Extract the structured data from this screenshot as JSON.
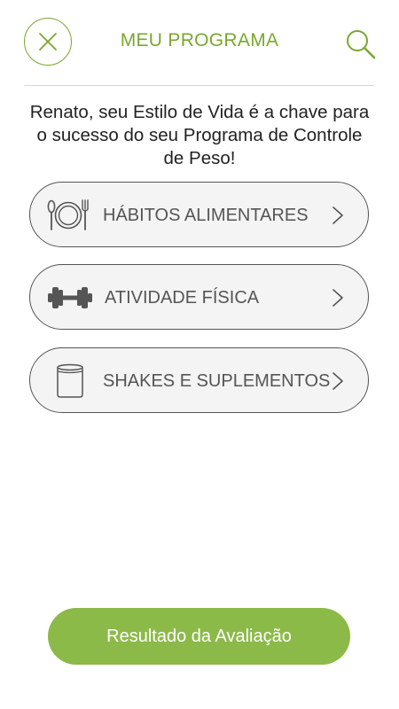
{
  "header": {
    "title": "MEU PROGRAMA",
    "close_icon": "close-icon",
    "search_icon": "search-icon"
  },
  "intro": {
    "text": "Renato, seu Estilo de Vida é a chave para o sucesso do seu Programa de Controle de Peso!"
  },
  "menu": {
    "items": [
      {
        "label": "HÁBITOS ALIMENTARES",
        "icon": "plate-cutlery-icon"
      },
      {
        "label": "ATIVIDADE FÍSICA",
        "icon": "dumbbell-icon"
      },
      {
        "label": "SHAKES E SUPLEMENTOS",
        "icon": "canister-icon"
      }
    ]
  },
  "footer": {
    "button_label": "Resultado da Avaliação"
  },
  "colors": {
    "accent": "#7aa72e",
    "button": "#8cba48",
    "item_background": "#f4f4f4",
    "item_text": "#555555"
  }
}
